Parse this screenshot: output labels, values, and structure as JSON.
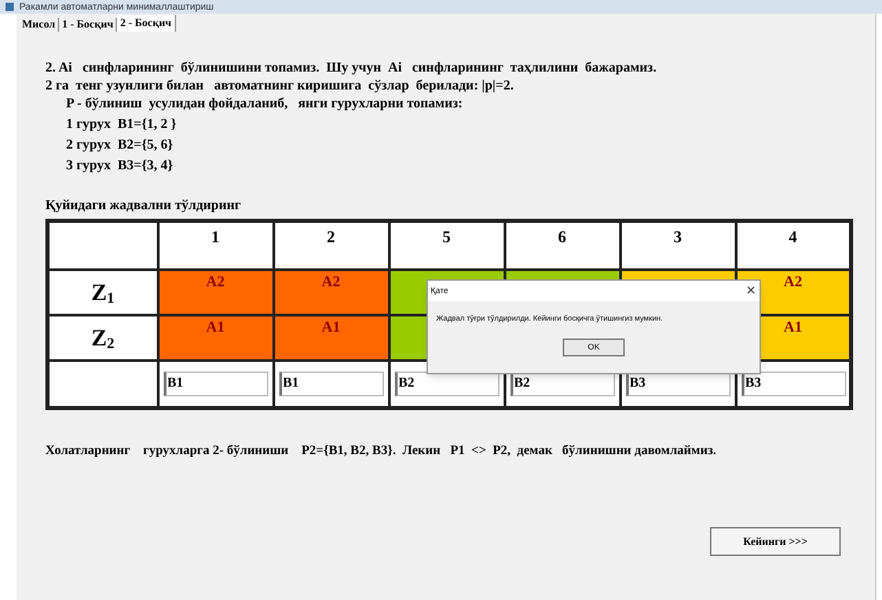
{
  "window": {
    "title": "Ракамли автоматларни минималлаштириш"
  },
  "tabs": [
    {
      "label": "Мисол",
      "selected": false
    },
    {
      "label": "1 - Босқич",
      "selected": false
    },
    {
      "label": "2 - Босқич",
      "selected": true
    }
  ],
  "intro": [
    "2. Ai   синфларининг  бўлинишини топамиз.  Шу учун  Ai   синфларининг  таҳлилини  бажарамиз.",
    "2 га  тенг узунлиги билан   автоматнинг киришига  сўзлар  берилади: |p|=2."
  ],
  "method": "P - бўлиниш  усулидан фойдаланиб,   янги гурухларни топамиз:",
  "groups": [
    "1 гурух  B1={1, 2 }",
    "2 гурух  B2={5, 6}",
    "3 гурух  B3={3, 4}"
  ],
  "table_caption": "Қуйидаги жадвални тўлдиринг",
  "table": {
    "columns": [
      "1",
      "2",
      "5",
      "6",
      "3",
      "4"
    ],
    "rows": [
      {
        "label": "Z",
        "index": "1",
        "cells": [
          {
            "text": "A2",
            "color": "#ff6600"
          },
          {
            "text": "A2",
            "color": "#ff6600"
          },
          {
            "color": "#99cc00"
          },
          {
            "color": "#99cc00"
          },
          {
            "color": "#ffcc00"
          },
          {
            "text": "A2",
            "color": "#ffcc00"
          }
        ]
      },
      {
        "label": "Z",
        "index": "2",
        "cells": [
          {
            "text": "A1",
            "color": "#ff6600"
          },
          {
            "text": "A1",
            "color": "#ff6600"
          },
          {
            "color": "#99cc00"
          },
          null,
          null,
          {
            "text": "A1",
            "color": "#ffcc00"
          }
        ]
      }
    ],
    "inputs": [
      "B1",
      "B1",
      "B2",
      "B2",
      "B3",
      "B3"
    ]
  },
  "conclusion": "Холатларнинг    гурухларга 2- бўлиниши    P2={B1, B2, B3}.  Лекин   P1  <>  P2,  демак   бўлинишни давомлаймиз.",
  "next_button": "Кейинги >>>",
  "dialog": {
    "title": "Қате",
    "message": "Жадвал тўғри тўлдирилди. Кейинги босқичга ўтишингиз мумкин.",
    "ok": "OK",
    "close": "✕"
  }
}
